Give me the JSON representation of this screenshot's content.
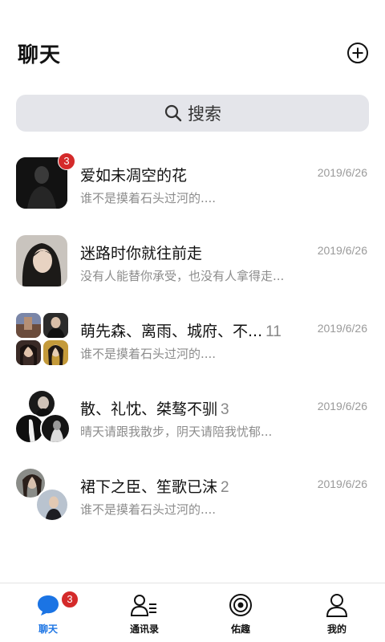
{
  "header": {
    "title": "聊天",
    "add_icon": "plus-circle-icon"
  },
  "search": {
    "label": "搜索",
    "icon": "search-icon"
  },
  "chats": [
    {
      "name": "爱如未凋空的花",
      "count": "",
      "date": "2019/6/26",
      "preview": "谁不是摸着石头过河的....",
      "badge": "3"
    },
    {
      "name": "迷路时你就往前走",
      "count": "",
      "date": "2019/6/26",
      "preview": "没有人能替你承受，也没有人拿得走...",
      "badge": ""
    },
    {
      "name": "萌先森、离雨、城府、不...",
      "count": "11",
      "date": "2019/6/26",
      "preview": "谁不是摸着石头过河的....",
      "badge": ""
    },
    {
      "name": "散、礼忱、桀骜不驯",
      "count": "3",
      "date": "2019/6/26",
      "preview": "晴天请跟我散步，阴天请陪我忧郁...",
      "badge": ""
    },
    {
      "name": "裙下之臣、笙歌已沫",
      "count": "2",
      "date": "2019/6/26",
      "preview": "谁不是摸着石头过河的....",
      "badge": ""
    }
  ],
  "tabs": [
    {
      "label": "聊天",
      "icon": "chat-bubble-icon",
      "active": true,
      "badge": "3"
    },
    {
      "label": "通讯录",
      "icon": "contacts-icon",
      "active": false,
      "badge": ""
    },
    {
      "label": "佑趣",
      "icon": "discover-icon",
      "active": false,
      "badge": ""
    },
    {
      "label": "我的",
      "icon": "profile-icon",
      "active": false,
      "badge": ""
    }
  ],
  "colors": {
    "accent": "#1b74e4",
    "badge": "#d42a2a",
    "search_bg": "#e4e5ea"
  }
}
